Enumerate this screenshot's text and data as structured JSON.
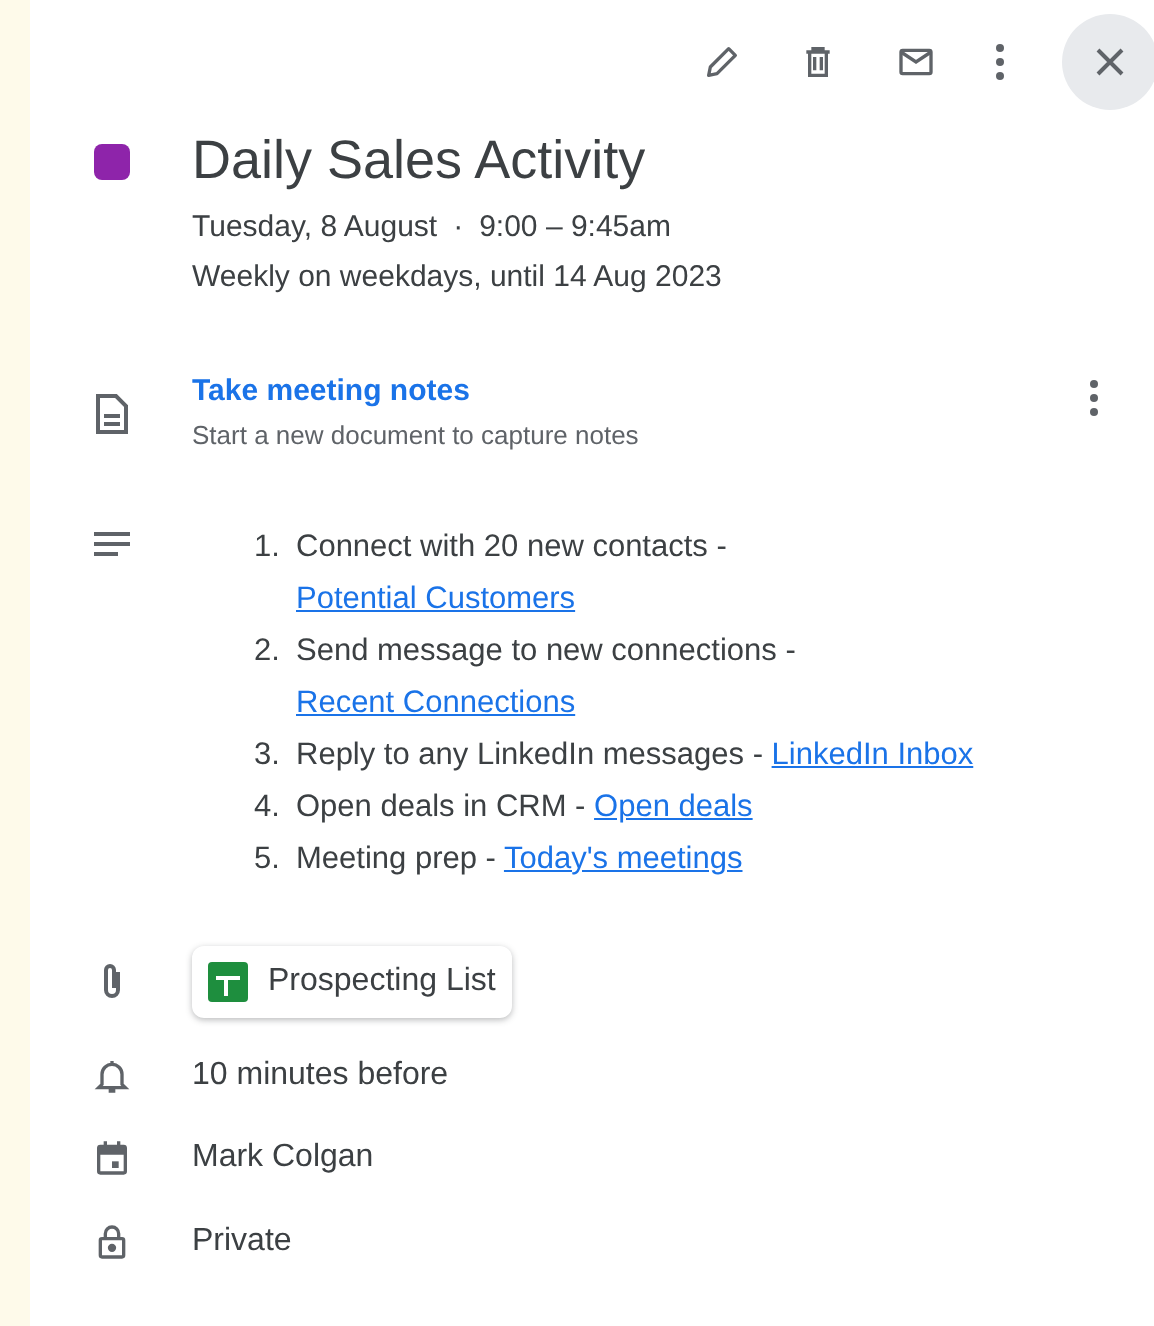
{
  "event": {
    "title": "Daily Sales Activity",
    "color": "#8e24aa",
    "date": "Tuesday, 8 August",
    "separator": "·",
    "time": "9:00 – 9:45am",
    "recurrence": "Weekly on weekdays, until 14 Aug 2023"
  },
  "notes": {
    "link": "Take meeting notes",
    "subtitle": "Start a new document to capture notes"
  },
  "description": [
    {
      "number": "1.",
      "text": "Connect with 20 new contacts - ",
      "link": "Potential Customers"
    },
    {
      "number": "2.",
      "text": "Send message to new connections - ",
      "link": "Recent Connections"
    },
    {
      "number": "3.",
      "text": "Reply to any LinkedIn messages - ",
      "link": "LinkedIn Inbox"
    },
    {
      "number": "4.",
      "text": "Open deals in CRM - ",
      "link": "Open deals"
    },
    {
      "number": "5.",
      "text": "Meeting prep - ",
      "link": "Today's meetings"
    }
  ],
  "attachment": {
    "name": "Prospecting List"
  },
  "details": [
    {
      "kind": "reminder",
      "text": "10 minutes before"
    },
    {
      "kind": "calendar",
      "text": "Mark Colgan"
    },
    {
      "kind": "visibility",
      "text": "Private"
    }
  ]
}
